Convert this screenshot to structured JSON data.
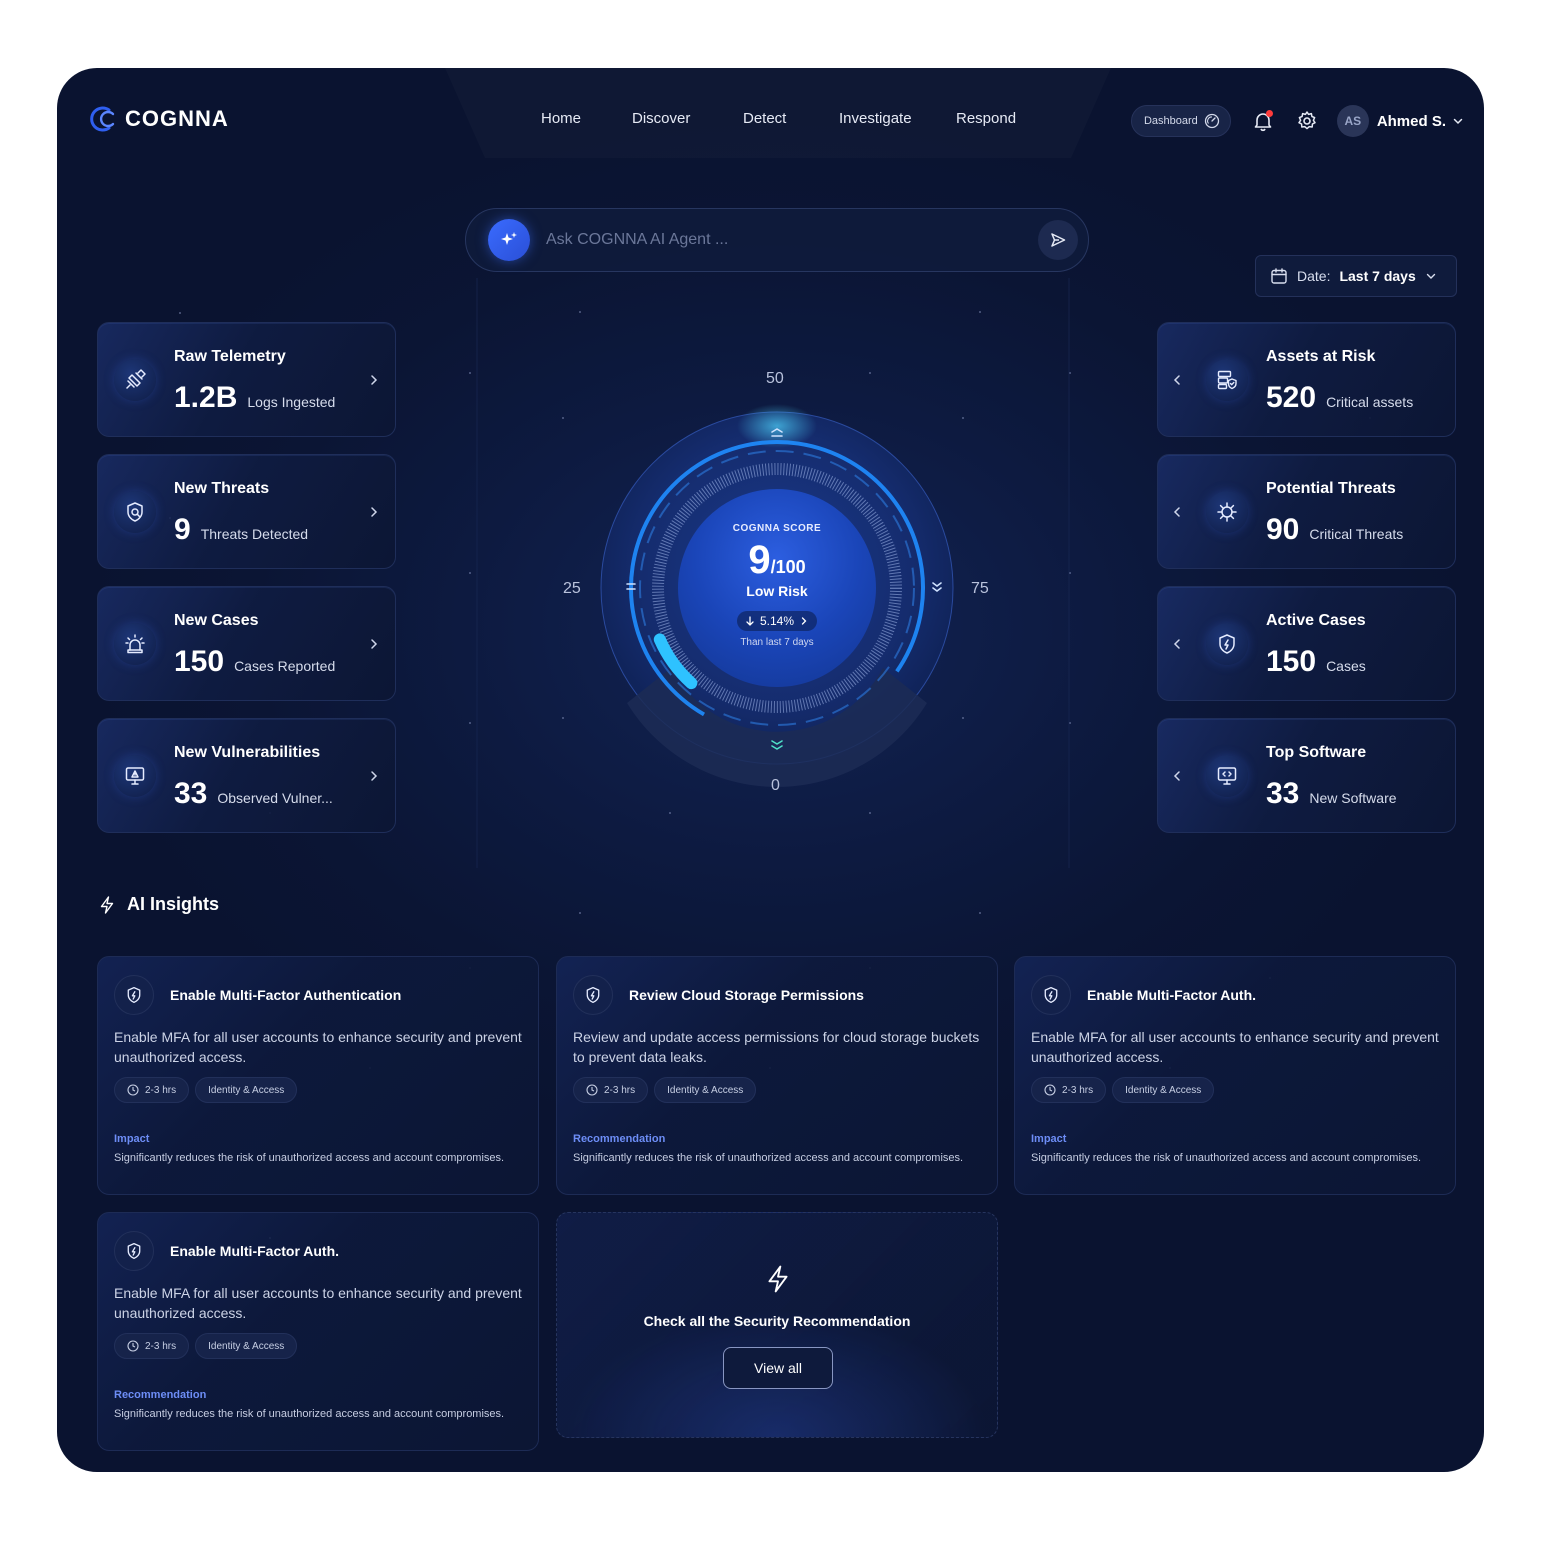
{
  "brand": {
    "name": "COGNNA"
  },
  "nav": {
    "items": [
      "Home",
      "Discover",
      "Detect",
      "Investigate",
      "Respond"
    ]
  },
  "header": {
    "dashboard_label": "Dashboard",
    "user_initials": "AS",
    "user_name": "Ahmed S."
  },
  "search": {
    "placeholder": "Ask COGNNA AI Agent ..."
  },
  "date_filter": {
    "prefix": "Date:",
    "value": "Last 7 days"
  },
  "left_stats": [
    {
      "title": "Raw Telemetry",
      "value": "1.2B",
      "sub": "Logs Ingested",
      "icon": "satellite-icon"
    },
    {
      "title": "New Threats",
      "value": "9",
      "sub": "Threats Detected",
      "icon": "shield-search-icon"
    },
    {
      "title": "New Cases",
      "value": "150",
      "sub": "Cases Reported",
      "icon": "alarm-icon"
    },
    {
      "title": "New Vulnerabilities",
      "value": "33",
      "sub": "Observed Vulner...",
      "icon": "monitor-warning-icon"
    }
  ],
  "right_stats": [
    {
      "title": "Assets at Risk",
      "value": "520",
      "sub": "Critical assets",
      "icon": "server-shield-icon"
    },
    {
      "title": "Potential Threats",
      "value": "90",
      "sub": "Critical Threats",
      "icon": "virus-icon"
    },
    {
      "title": "Active Cases",
      "value": "150",
      "sub": "Cases",
      "icon": "shield-bolt-icon"
    },
    {
      "title": "Top Software",
      "value": "33",
      "sub": "New Software",
      "icon": "monitor-code-icon"
    }
  ],
  "gauge": {
    "title": "COGNNA SCORE",
    "score": "9",
    "max": "/100",
    "score_value": 9,
    "score_max": 100,
    "risk": "Low Risk",
    "delta": "5.14%",
    "delta_note": "Than last 7 days",
    "labels": {
      "top": "50",
      "left": "25",
      "right": "75",
      "bottom": "0"
    }
  },
  "insights": {
    "heading": "AI Insights",
    "cards": [
      {
        "title": "Enable Multi-Factor Authentication",
        "desc": "Enable MFA for all user accounts to enhance security and prevent unauthorized access.",
        "time": "2-3 hrs",
        "category": "Identity & Access",
        "label": "Impact",
        "text": "Significantly reduces the risk of unauthorized access and account compromises."
      },
      {
        "title": "Review Cloud Storage Permissions",
        "desc": "Review and update access permissions for cloud storage buckets to prevent data leaks.",
        "time": "2-3 hrs",
        "category": "Identity & Access",
        "label": "Recommendation",
        "text": "Significantly reduces the risk of unauthorized access and account compromises."
      },
      {
        "title": "Enable Multi-Factor Auth.",
        "desc": "Enable MFA for all user accounts to enhance security and prevent unauthorized access.",
        "time": "2-3 hrs",
        "category": "Identity & Access",
        "label": "Impact",
        "text": "Significantly reduces the risk of unauthorized access and account compromises."
      },
      {
        "title": "Enable Multi-Factor Auth.",
        "desc": "Enable MFA for all user accounts to enhance security and prevent unauthorized access.",
        "time": "2-3 hrs",
        "category": "Identity & Access",
        "label": "Recommendation",
        "text": "Significantly reduces the risk of unauthorized access and account compromises."
      }
    ],
    "cta": {
      "title": "Check all the Security Recommendation",
      "button": "View all"
    }
  },
  "colors": {
    "accent": "#3a6bff",
    "highlight": "#6d8df6",
    "bg": "#0b1534",
    "notification": "#ff3b3b"
  }
}
